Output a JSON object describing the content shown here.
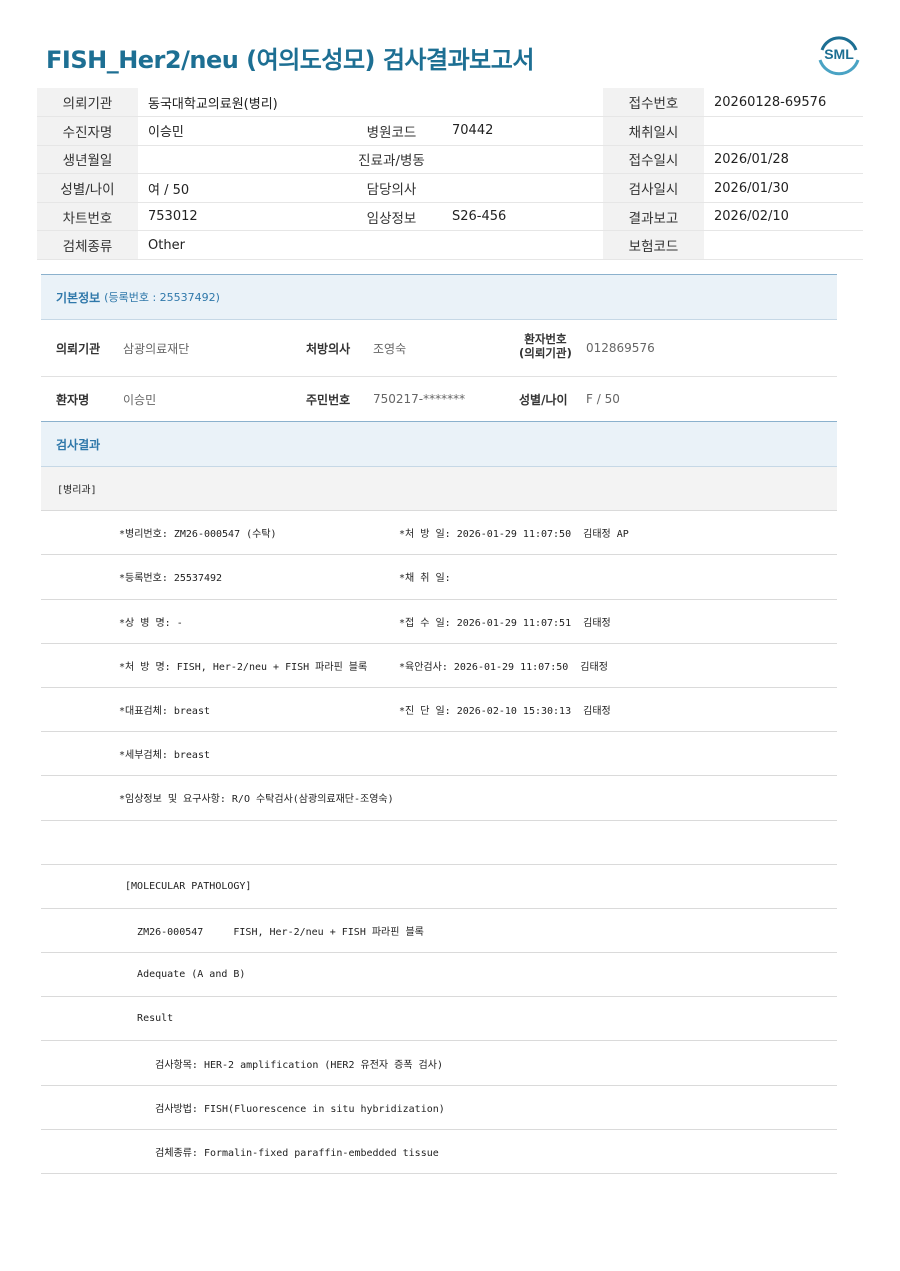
{
  "title": "FISH_Her2/neu (여의도성모) 검사결과보고서",
  "logo_text": "SML",
  "header": [
    [
      "의뢰기관",
      "동국대학교의료원(병리)",
      "",
      "",
      "접수번호",
      "20260128-69576"
    ],
    [
      "수진자명",
      "이승민",
      "병원코드",
      "70442",
      "채취일시",
      ""
    ],
    [
      "생년월일",
      "",
      "진료과/병동",
      "",
      "접수일시",
      "2026/01/28"
    ],
    [
      "성별/나이",
      "여 / 50",
      "담당의사",
      "",
      "검사일시",
      "2026/01/30"
    ],
    [
      "차트번호",
      "753012",
      "임상정보",
      "S26-456",
      "결과보고",
      "2026/02/10"
    ],
    [
      "검체종류",
      "Other",
      "",
      "",
      "보험코드",
      ""
    ]
  ],
  "basic": {
    "title": "기본정보",
    "sub": "(등록번호 : 25537492)",
    "row1": {
      "k1": "의뢰기관",
      "v1": "삼광의료재단",
      "k2": "처방의사",
      "v2": "조영숙",
      "k3a": "환자번호",
      "k3b": "(의뢰기관)",
      "v3": "012869576"
    },
    "row2": {
      "k1": "환자명",
      "v1": "이승민",
      "k2": "주민번호",
      "v2": "750217-*******",
      "k3": "성별/나이",
      "v3": "F / 50"
    }
  },
  "results": {
    "title": "검사결과",
    "dept": "[병리과]",
    "pairs": [
      [
        "*병리번호: ZM26-000547 (수탁)",
        "*처 방 일: 2026-01-29 11:07:50  김태정 AP"
      ],
      [
        "*등록번호: 25537492",
        "*채 취 일:"
      ],
      [
        "*상 병 명: -",
        "*접 수 일: 2026-01-29 11:07:51  김태정"
      ],
      [
        "*처 방 명: FISH, Her-2/neu + FISH 파라핀 블록",
        "*육안검사: 2026-01-29 11:07:50  김태정"
      ],
      [
        "*대표검체: breast",
        "*진 단 일: 2026-02-10 15:30:13  김태정"
      ],
      [
        "*세부검체: breast",
        ""
      ],
      [
        "*임상정보 및 요구사항: R/O 수탁검사(삼광의료재단-조영숙)",
        ""
      ]
    ],
    "lines": [
      "",
      " [MOLECULAR PATHOLOGY]",
      "   ZM26-000547     FISH, Her-2/neu + FISH 파라핀 블록",
      "   Adequate (A and B)",
      "   Result",
      "      검사항목: HER-2 amplification (HER2 유전자 증폭 검사)",
      "      검사방법: FISH(Fluorescence in situ hybridization)",
      "      검체종류: Formalin-fixed paraffin-embedded tissue"
    ]
  }
}
